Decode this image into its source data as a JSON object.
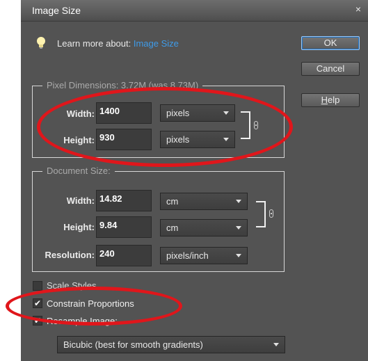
{
  "title": "Image Size",
  "close_icon": "×",
  "learn_more": {
    "prefix": "Learn more about:",
    "link": "Image Size"
  },
  "buttons": {
    "ok": "OK",
    "cancel": "Cancel",
    "help_first": "H",
    "help_rest": "elp"
  },
  "pixel_dimensions": {
    "title": "Pixel Dimensions: 3.72M (was 8.73M)",
    "width_label": "Width:",
    "width_value": "1400",
    "width_unit": "pixels",
    "height_label": "Height:",
    "height_value": "930",
    "height_unit": "pixels"
  },
  "document_size": {
    "title": "Document Size:",
    "width_label": "Width:",
    "width_value": "14.82",
    "width_unit": "cm",
    "height_label": "Height:",
    "height_value": "9.84",
    "height_unit": "cm",
    "resolution_label": "Resolution:",
    "resolution_value": "240",
    "resolution_unit": "pixels/inch"
  },
  "options": {
    "scale_styles": "Scale Styles",
    "scale_styles_checked": false,
    "constrain_proportions": "Constrain Proportions",
    "constrain_checked": true,
    "resample_image": "Resample Image:",
    "resample_checked": true,
    "resample_method": "Bicubic (best for smooth gradients)"
  },
  "check_glyph": "✔",
  "colors": {
    "dialog_bg": "#535353",
    "link": "#3f9be8",
    "annotation_red": "#e0161b"
  }
}
